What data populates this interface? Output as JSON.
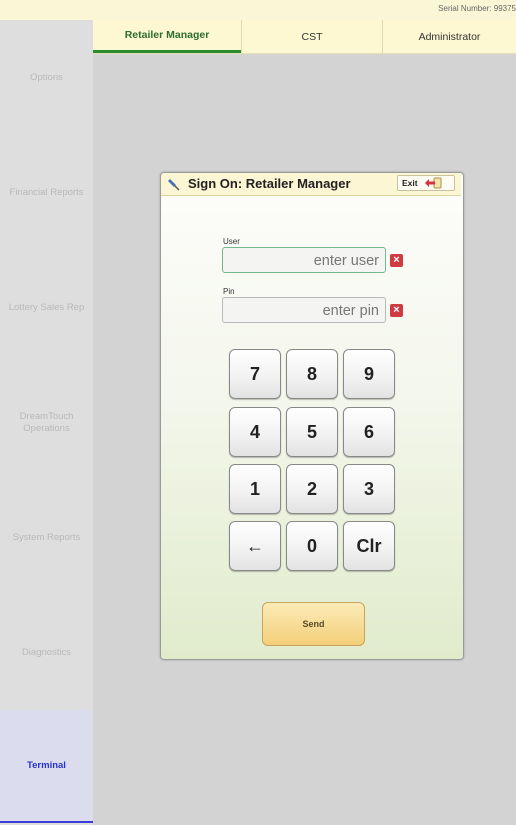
{
  "header": {
    "serial_text": "Serial Number: 99375"
  },
  "tabs": [
    {
      "label": "Retailer Manager",
      "active": true
    },
    {
      "label": "CST",
      "active": false
    },
    {
      "label": "Administrator",
      "active": false
    }
  ],
  "sidebar": {
    "items": [
      {
        "label": "Options"
      },
      {
        "label": "Financial Reports"
      },
      {
        "label": "Lottery Sales Rep"
      },
      {
        "label": "DreamTouch Operations"
      },
      {
        "label": "System Reports"
      },
      {
        "label": "Diagnostics"
      },
      {
        "label": "Terminal",
        "active": true
      }
    ]
  },
  "dialog": {
    "title": "Sign On: Retailer Manager",
    "exit_label": "Exit",
    "user_label": "User",
    "user_placeholder": "enter user",
    "pin_label": "Pin",
    "pin_placeholder": "enter pin",
    "clear_symbol": "×",
    "keys": [
      "7",
      "8",
      "9",
      "4",
      "5",
      "6",
      "1",
      "2",
      "3",
      "←",
      "0",
      "Clr"
    ],
    "send_label": "Send"
  },
  "colors": {
    "tab_active": "#2b8a2b",
    "sidebar_active_text": "#2633cc",
    "clear_button": "#cf3b43",
    "send_button": "#f2cf7a"
  },
  "icons": {
    "dialog_icon": "pin-icon",
    "exit_icon": "exit-arrow-icon",
    "clear_icon": "clear-x-icon"
  }
}
